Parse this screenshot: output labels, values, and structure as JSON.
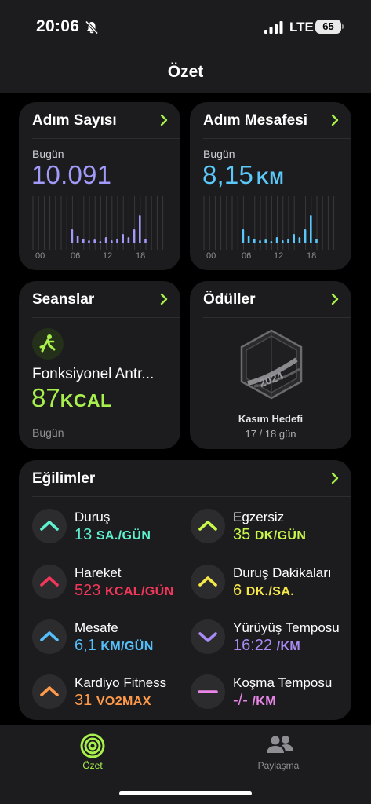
{
  "status_bar": {
    "time": "20:06",
    "network": "LTE",
    "battery": "65"
  },
  "nav": {
    "title": "Özet"
  },
  "steps_card": {
    "title": "Adım Sayısı",
    "day_label": "Bugün",
    "value": "10.091",
    "color": "#a19af9",
    "tick_labels": [
      "00",
      "06",
      "12",
      "18"
    ]
  },
  "distance_card": {
    "title": "Adım Mesafesi",
    "day_label": "Bugün",
    "value": "8,15",
    "unit": "KM",
    "color": "#5ac8fa",
    "tick_labels": [
      "00",
      "06",
      "12",
      "18"
    ]
  },
  "sessions_card": {
    "title": "Seanslar",
    "icon": "functional-training-icon",
    "activity": "Fonksiyonel Antr...",
    "value": "87",
    "unit": "KCAL",
    "day_label": "Bugün"
  },
  "awards_card": {
    "title": "Ödüller",
    "badge_icon": "monthly-challenge-badge-icon",
    "badge_name": "Kasım Hedefi",
    "badge_progress": "17 / 18 gün"
  },
  "trends_card": {
    "title": "Eğilimler",
    "items": [
      {
        "label": "Duruş",
        "value": "13",
        "unit": "SA./GÜN",
        "direction": "up",
        "color": "#5ff2d0"
      },
      {
        "label": "Egzersiz",
        "value": "35",
        "unit": "DK/GÜN",
        "direction": "up",
        "color": "#c9f84a"
      },
      {
        "label": "Hareket",
        "value": "523",
        "unit": "KCAL/GÜN",
        "direction": "up",
        "color": "#f2375a"
      },
      {
        "label": "Duruş Dakikaları",
        "value": "6",
        "unit": "DK./SA.",
        "direction": "up",
        "color": "#f5e64a"
      },
      {
        "label": "Mesafe",
        "value": "6,1",
        "unit": "KM/GÜN",
        "direction": "up",
        "color": "#56bffb"
      },
      {
        "label": "Yürüyüş Temposu",
        "value": "16:22",
        "unit": "/KM",
        "direction": "down",
        "color": "#a98bf3"
      },
      {
        "label": "Kardiyo Fitness",
        "value": "31",
        "unit": "VO2MAX",
        "direction": "up",
        "color": "#ff9a4a"
      },
      {
        "label": "Koşma Temposu",
        "value": "-/-",
        "unit": "/KM",
        "direction": "flat",
        "color": "#e986e8"
      }
    ]
  },
  "tab_bar": {
    "tabs": [
      {
        "label": "Özet",
        "icon": "activity-rings-icon",
        "active": true
      },
      {
        "label": "Paylaşma",
        "icon": "sharing-people-icon",
        "active": false
      }
    ]
  }
}
